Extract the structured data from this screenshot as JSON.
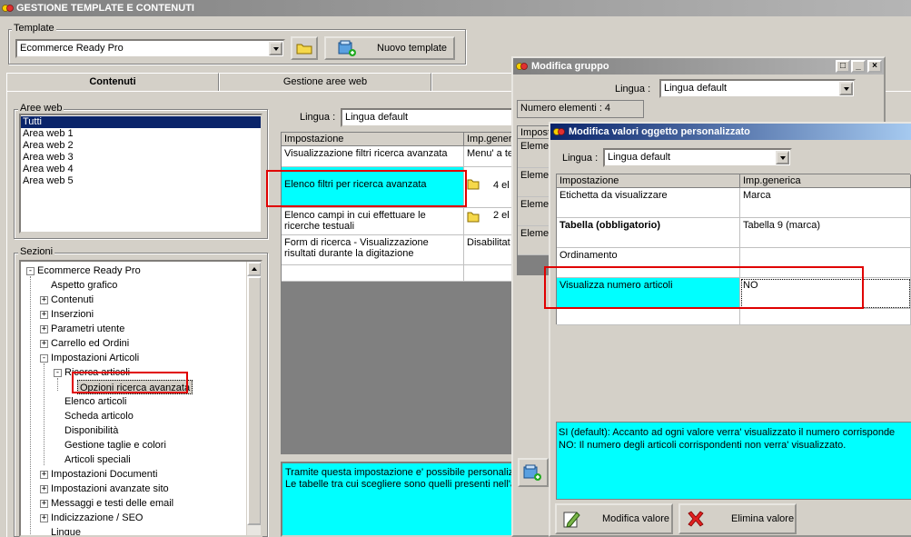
{
  "app": {
    "title": "GESTIONE TEMPLATE E CONTENUTI"
  },
  "template": {
    "group_label": "Template",
    "selected": "Ecommerce Ready Pro",
    "new_button": "Nuovo template"
  },
  "tabs": [
    {
      "label": "Contenuti"
    },
    {
      "label": "Gestione aree web"
    }
  ],
  "aree_web": {
    "label": "Aree web",
    "items": [
      "Tutti",
      "Area web 1",
      "Area web 2",
      "Area web 3",
      "Area web 4",
      "Area web 5"
    ]
  },
  "sezioni": {
    "label": "Sezioni",
    "items": [
      "Ecommerce Ready Pro",
      "Aspetto grafico",
      "Contenuti",
      "Inserzioni",
      "Parametri utente",
      "Carrello ed Ordini",
      "Impostazioni Articoli",
      "Ricerca articoli",
      "Opzioni ricerca avanzata",
      "Elenco articoli",
      "Scheda articolo",
      "Disponibilità",
      "Gestione taglie e colori",
      "Articoli speciali",
      "Impostazioni Documenti",
      "Impostazioni avanzate sito",
      "Messaggi e testi delle email",
      "Indicizzazione / SEO",
      "Lingue"
    ]
  },
  "main": {
    "lingua_label": "Lingua :",
    "lingua_value": "Lingua default",
    "headers": [
      "Impostazione",
      "Imp.gener"
    ],
    "rows": [
      {
        "name": "Visualizzazione filtri ricerca avanzata",
        "value": "Menu' a te"
      },
      {
        "name": "Elenco filtri per ricerca avanzata",
        "value": "4 el"
      },
      {
        "name": "Elenco campi in cui effettuare le ricerche testuali",
        "value": "2 el"
      },
      {
        "name": "Form di ricerca - Visualizzazione risultati durante la digitazione",
        "value": "Disabilitat"
      }
    ],
    "description": "Tramite questa impostazione e' possibile personalizz\nLe tabelle tra cui scegliere sono quelli presenti nell'a"
  },
  "gruppo": {
    "title": "Modifica gruppo",
    "lingua_label": "Lingua :",
    "lingua_value": "Lingua default",
    "count": "Numero elementi : 4",
    "header": "Impost",
    "rows": [
      "Eleme",
      "Eleme",
      "Eleme",
      "Eleme"
    ]
  },
  "valori": {
    "title": "Modifica valori oggetto personalizzato",
    "lingua_label": "Lingua :",
    "lingua_value": "Lingua default",
    "headers": [
      "Impostazione",
      "Imp.generica"
    ],
    "rows": [
      {
        "name": "Etichetta da visualizzare",
        "value": "Marca"
      },
      {
        "name": "Tabella (obbligatorio)",
        "value": "Tabella 9 (marca)"
      },
      {
        "name": "Ordinamento",
        "value": ""
      },
      {
        "name": "Visualizza numero articoli",
        "value": "NO"
      }
    ],
    "description_1": "SI (default): Accanto ad ogni valore verra' visualizzato il numero corrisponde",
    "description_2": "NO: Il numero degli articoli corrispondenti non verra' visualizzato.",
    "modify_button": "Modifica valore",
    "delete_button": "Elimina valore"
  },
  "colors": {
    "highlight": "#00ffff",
    "selection": "#0a246a",
    "annotation": "#e00000"
  }
}
